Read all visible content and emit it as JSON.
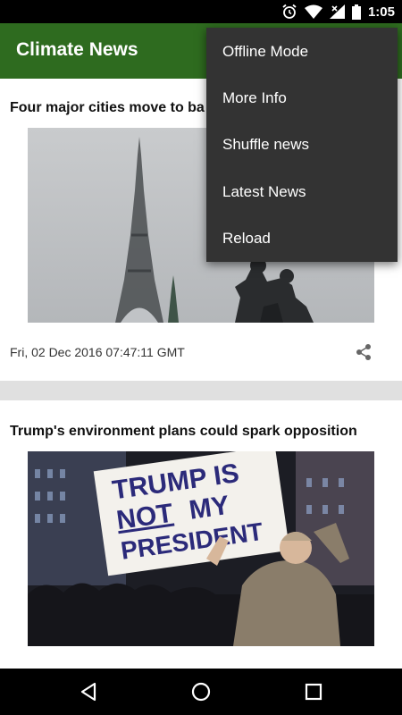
{
  "status_bar": {
    "time": "1:05",
    "icons": [
      "alarm-icon",
      "wifi-icon",
      "signal-icon",
      "battery-icon"
    ]
  },
  "app_bar": {
    "title": "Climate News"
  },
  "articles": [
    {
      "headline": "Four major cities move to ba",
      "date": "Fri, 02 Dec 2016 07:47:11 GMT",
      "image": "eiffel-tower-in-fog"
    },
    {
      "headline": "Trump's environment plans could spark opposition",
      "image": "protest-sign",
      "sign_lines": [
        "TRUMP IS",
        "NOT",
        "MY",
        "PRESIDENT"
      ]
    }
  ],
  "overflow_menu": {
    "items": [
      {
        "label": "Offline Mode"
      },
      {
        "label": "More Info"
      },
      {
        "label": "Shuffle news"
      },
      {
        "label": "Latest News"
      },
      {
        "label": "Reload"
      }
    ]
  },
  "nav_bar": {
    "buttons": [
      "back-icon",
      "home-icon",
      "recents-icon"
    ]
  },
  "colors": {
    "app_bar": "#2e6b1f",
    "menu_bg": "#333333",
    "status_bar": "#000000"
  }
}
